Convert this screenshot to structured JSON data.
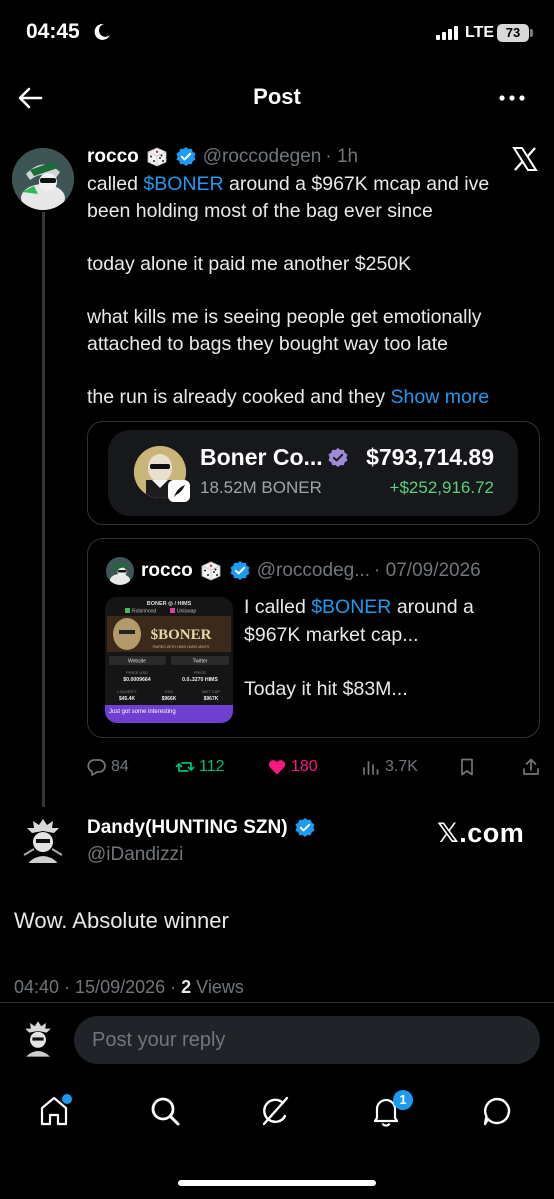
{
  "status_bar": {
    "time": "04:45",
    "network": "LTE",
    "battery": "73"
  },
  "header": {
    "title": "Post"
  },
  "post": {
    "author": "rocco",
    "handle": "@roccodegen",
    "time": "· 1h",
    "line1_pre": "called ",
    "cashtag": "$BONER",
    "line1_post": " around a $967K mcap and ive been holding most of the bag ever since",
    "para2": "today alone it paid me another $250K",
    "para3": "what kills me is seeing people get emotionally attached to bags they bought way too late",
    "para4": "the run is already cooked and they ",
    "show_more": "Show more"
  },
  "token_card": {
    "name": "Boner Co...",
    "amount": "18.52M BONER",
    "value": "$793,714.89",
    "change": "+$252,916.72"
  },
  "quote": {
    "author": "rocco",
    "handle": "@roccodeg...",
    "date": "· 07/09/2026",
    "text_pre": "I called ",
    "cashtag": "$BONER",
    "text_post": " around a $967K market cap...",
    "text2": "Today it hit $83M...",
    "thumb": {
      "pair": "BONER ◎ / HIMS",
      "source_a": "Robinhood",
      "source_b": "Uniswap",
      "banner": "$BONER",
      "tagline": "PAIRED WITH HIMS HARD MINTS",
      "website": "Website",
      "twitter": "Twitter",
      "price_usd_label": "PRICE USD",
      "price_usd": "$0.0009664",
      "price_label": "PRICE",
      "price": "0.0₄3270 HIMS",
      "liquidity_label": "LIQUIDITY",
      "liquidity": "$45.4K",
      "fdv_label": "FDV",
      "fdv": "$966K",
      "mcap_label": "MKT CAP",
      "mcap": "$967K",
      "footer": "Just got some interesting"
    }
  },
  "actions": {
    "replies": "84",
    "reposts": "112",
    "likes": "180",
    "views": "3.7K"
  },
  "reply": {
    "name": "Dandy(HUNTING SZN)",
    "handle": "@iDandizzi",
    "brand": "𝕏.com",
    "text": "Wow. Absolute winner",
    "timestamp": "04:40 · 15/09/2026 · ",
    "views_count": "2",
    "views_label": " Views"
  },
  "composer": {
    "placeholder": "Post your reply"
  },
  "tabbar": {
    "notifications_count": "1"
  },
  "colors": {
    "accent": "#1d9bf0",
    "like": "#f91880",
    "repost": "#00ba7c",
    "positive": "#5ad07a",
    "background": "#000000"
  }
}
